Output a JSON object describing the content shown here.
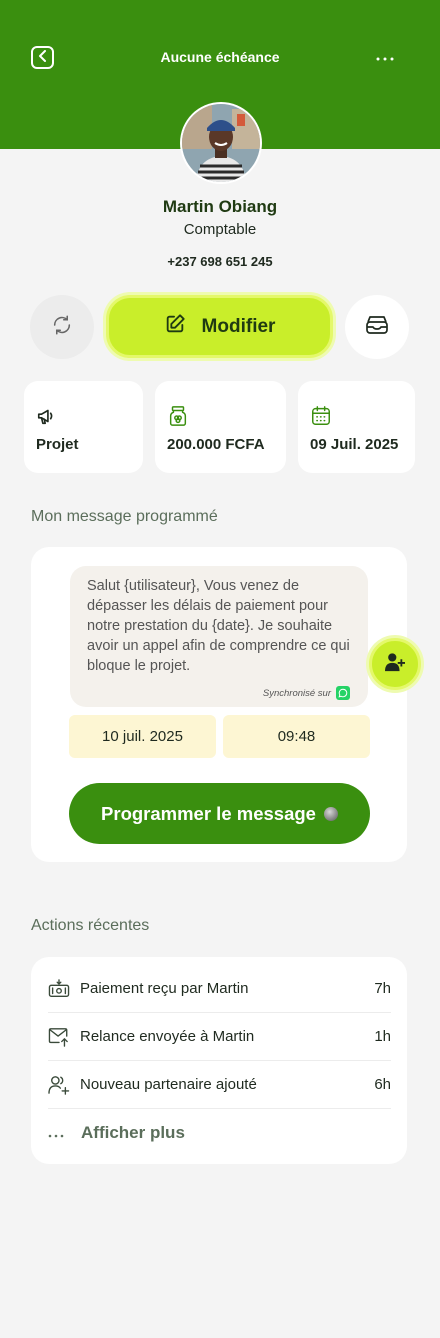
{
  "header": {
    "title": "Aucune échéance",
    "back_icon": "chevron-left-icon",
    "more_icon": "ellipsis-icon",
    "color": "#3a8f0f"
  },
  "profile": {
    "name": "Martin Obiang",
    "role": "Comptable",
    "phone": "+237 698 651 245"
  },
  "actions_bar": {
    "refresh_icon": "refresh-icon",
    "edit_label": "Modifier",
    "edit_icon": "edit-icon",
    "archive_icon": "archive-icon",
    "accent": "#c9ee2a"
  },
  "info_cards": [
    {
      "icon": "megaphone-icon",
      "label": "Projet"
    },
    {
      "icon": "money-jar-icon",
      "label": "200.000 FCFA"
    },
    {
      "icon": "calendar-icon",
      "label": "09 Juil. 2025"
    }
  ],
  "scheduled": {
    "title": "Mon message programmé",
    "message": "Salut {utilisateur}, Vous venez de dépasser les délais de paiement pour notre prestation du  {date}. Je souhaite avoir un appel afin de comprendre ce qui bloque le projet.",
    "sync_label": "Synchronisé sur",
    "sync_icon": "whatsapp-icon",
    "date": "10 juil. 2025",
    "time": "09:48",
    "button_label": "Programmer le message",
    "button_icon": "globe-icon"
  },
  "recent": {
    "title": "Actions récentes",
    "items": [
      {
        "icon": "cash-icon",
        "label": "Paiement reçu par Martin",
        "time": "7h"
      },
      {
        "icon": "mail-send-icon",
        "label": "Relance envoyée à Martin",
        "time": "1h"
      },
      {
        "icon": "user-add-icon",
        "label": "Nouveau partenaire ajouté",
        "time": "6h"
      }
    ],
    "more_label": "Afficher plus",
    "more_icon": "ellipsis-icon"
  }
}
